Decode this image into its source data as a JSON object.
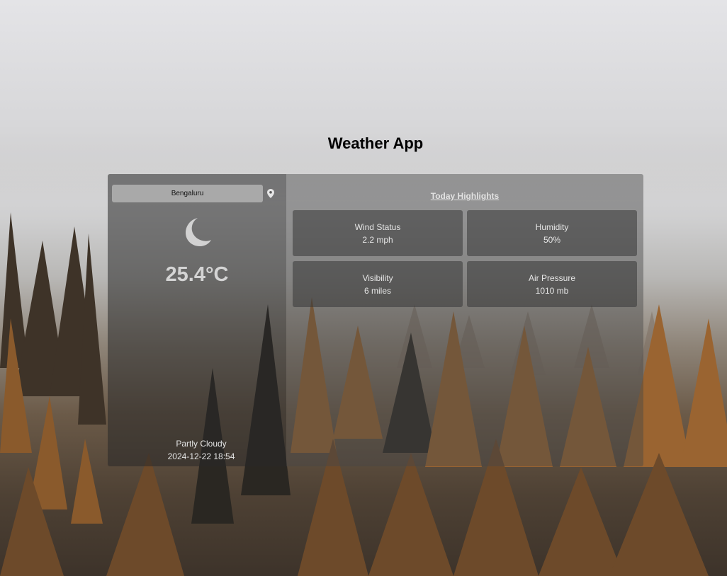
{
  "app": {
    "title": "Weather App"
  },
  "search": {
    "value": "Bengaluru",
    "placeholder": ""
  },
  "current": {
    "icon": "moon-icon",
    "temperature": "25.4°C",
    "condition": "Partly Cloudy",
    "datetime": "2024-12-22 18:54"
  },
  "highlights": {
    "title": "Today Highlights",
    "items": [
      {
        "label": "Wind Status",
        "value": "2.2 mph"
      },
      {
        "label": "Humidity",
        "value": "50%"
      },
      {
        "label": "Visibility",
        "value": "6 miles"
      },
      {
        "label": "Air Pressure",
        "value": "1010 mb"
      }
    ]
  },
  "colors": {
    "text_dark": "#000000",
    "input_bg": "#a9a9a9",
    "temp_text": "#d4d4d4"
  }
}
